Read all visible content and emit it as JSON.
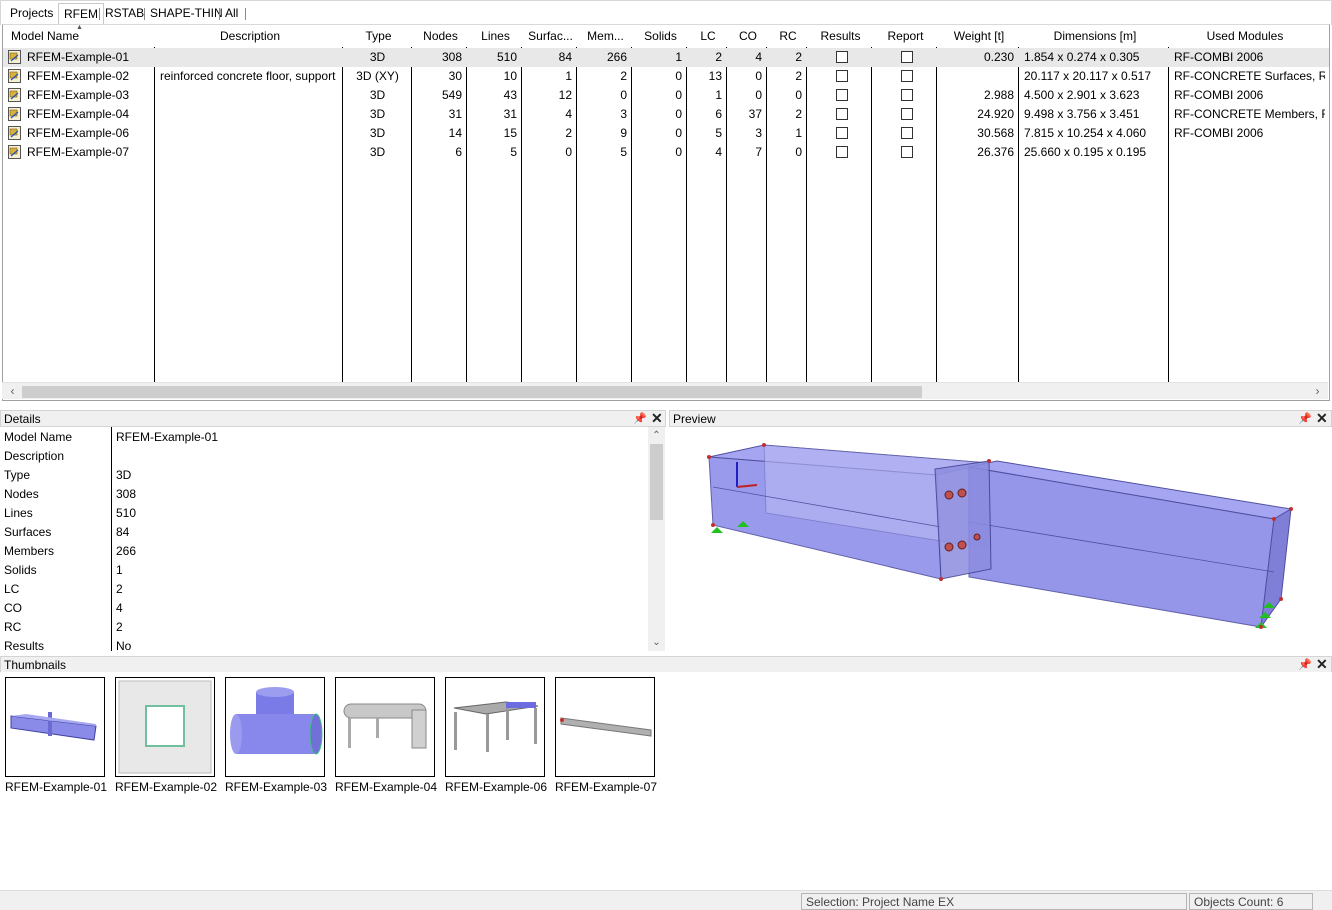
{
  "tabs": [
    "Projects",
    "RFEM",
    "RSTAB",
    "SHAPE-THIN",
    "All"
  ],
  "active_tab": "RFEM",
  "grid": {
    "columns": [
      "Model Name",
      "Description",
      "Type",
      "Nodes",
      "Lines",
      "Surfac...",
      "Mem...",
      "Solids",
      "LC",
      "CO",
      "RC",
      "Results",
      "Report",
      "Weight [t]",
      "Dimensions [m]",
      "Used Modules"
    ],
    "rows": [
      {
        "name": "RFEM-Example-01",
        "description": "",
        "type": "3D",
        "nodes": "308",
        "lines": "510",
        "surfaces": "84",
        "members": "266",
        "solids": "1",
        "lc": "2",
        "co": "4",
        "rc": "2",
        "weight": "0.230",
        "dimensions": "1.854 x 0.274 x 0.305",
        "modules": "RF-COMBI 2006"
      },
      {
        "name": "RFEM-Example-02",
        "description": "reinforced concrete floor, support",
        "type": "3D (XY)",
        "nodes": "30",
        "lines": "10",
        "surfaces": "1",
        "members": "2",
        "solids": "0",
        "lc": "13",
        "co": "0",
        "rc": "2",
        "weight": "",
        "dimensions": "20.117 x 20.117 x 0.517",
        "modules": "RF-CONCRETE Surfaces, RF"
      },
      {
        "name": "RFEM-Example-03",
        "description": "",
        "type": "3D",
        "nodes": "549",
        "lines": "43",
        "surfaces": "12",
        "members": "0",
        "solids": "0",
        "lc": "1",
        "co": "0",
        "rc": "0",
        "weight": "2.988",
        "dimensions": "4.500 x 2.901 x 3.623",
        "modules": "RF-COMBI 2006"
      },
      {
        "name": "RFEM-Example-04",
        "description": "",
        "type": "3D",
        "nodes": "31",
        "lines": "31",
        "surfaces": "4",
        "members": "3",
        "solids": "0",
        "lc": "6",
        "co": "37",
        "rc": "2",
        "weight": "24.920",
        "dimensions": "9.498 x 3.756 x 3.451",
        "modules": "RF-CONCRETE Members, R"
      },
      {
        "name": "RFEM-Example-06",
        "description": "",
        "type": "3D",
        "nodes": "14",
        "lines": "15",
        "surfaces": "2",
        "members": "9",
        "solids": "0",
        "lc": "5",
        "co": "3",
        "rc": "1",
        "weight": "30.568",
        "dimensions": "7.815 x 10.254 x 4.060",
        "modules": "RF-COMBI 2006"
      },
      {
        "name": "RFEM-Example-07",
        "description": "",
        "type": "3D",
        "nodes": "6",
        "lines": "5",
        "surfaces": "0",
        "members": "5",
        "solids": "0",
        "lc": "4",
        "co": "7",
        "rc": "0",
        "weight": "26.376",
        "dimensions": "25.660 x 0.195 x 0.195",
        "modules": ""
      }
    ]
  },
  "details": {
    "title": "Details",
    "rows": [
      {
        "label": "Model Name",
        "value": "RFEM-Example-01"
      },
      {
        "label": "Description",
        "value": ""
      },
      {
        "label": "Type",
        "value": "3D"
      },
      {
        "label": "Nodes",
        "value": "308"
      },
      {
        "label": "Lines",
        "value": "510"
      },
      {
        "label": "Surfaces",
        "value": "84"
      },
      {
        "label": "Members",
        "value": "266"
      },
      {
        "label": "Solids",
        "value": "1"
      },
      {
        "label": "LC",
        "value": "2"
      },
      {
        "label": "CO",
        "value": "4"
      },
      {
        "label": "RC",
        "value": "2"
      },
      {
        "label": "Results",
        "value": "No"
      }
    ]
  },
  "preview": {
    "title": "Preview"
  },
  "thumbnails": {
    "title": "Thumbnails",
    "items": [
      "RFEM-Example-01",
      "RFEM-Example-02",
      "RFEM-Example-03",
      "RFEM-Example-04",
      "RFEM-Example-06",
      "RFEM-Example-07"
    ]
  },
  "panel_icons": {
    "pin": "📌",
    "close": "✕"
  },
  "statusbar": {
    "selection": "Selection: Project Name EX",
    "objects_count": "Objects Count: 6"
  }
}
